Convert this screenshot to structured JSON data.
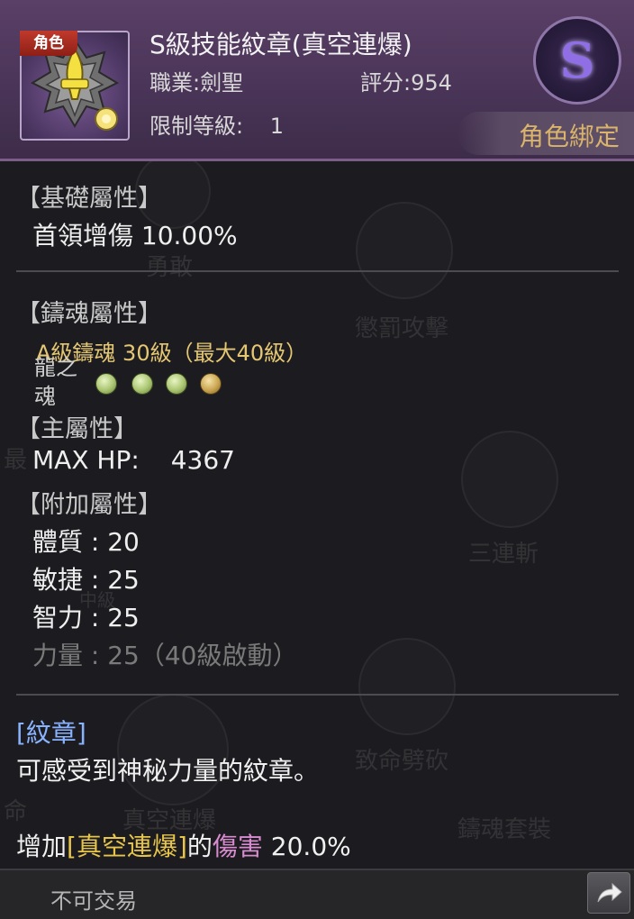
{
  "header": {
    "role_tag": "角色",
    "item_name": "S級技能紋章(真空連爆)",
    "job_label": "職業:",
    "job_value": "劍聖",
    "score_label": "評分:",
    "score_value": "954",
    "level_label": "限制等級:",
    "level_value": "1",
    "grade": "S",
    "bind_status": "角色綁定"
  },
  "basic": {
    "title": "【基礎屬性】",
    "stat": "首領增傷 10.00%"
  },
  "soul": {
    "title": "【鑄魂屬性】",
    "rank": "A級鑄魂 30級（最大40級）",
    "label": "龍之魂",
    "gem_count_green": 3,
    "gem_count_amber": 1
  },
  "main_attr": {
    "title": "【主屬性】",
    "stat_name": "MAX HP:",
    "stat_value": "4367"
  },
  "extra_attr": {
    "title": "【附加屬性】",
    "items": [
      "體質 : 20",
      "敏捷 : 25",
      "智力 : 25"
    ],
    "locked": "力量 : 25（40級啟動）"
  },
  "description": {
    "tag": "[紋章]",
    "text": "可感受到神秘力量的紋章。",
    "effect_prefix": "增加",
    "effect_skill": "[真空連爆]",
    "effect_mid": "的",
    "effect_dmg": "傷害",
    "effect_value": " 20.0%"
  },
  "background_nodes": [
    "勇敢",
    "懲罰攻擊",
    "三連斬",
    "致命劈砍",
    "真空連爆",
    "鑄魂套裝",
    "最",
    "中級",
    "命"
  ],
  "footer": {
    "trade_status": "不可交易"
  },
  "colors": {
    "header_bg": "#4a3558",
    "gold": "#e5c773",
    "bind": "#d9b46a",
    "tag_blue": "#8ab3ff",
    "damage_pink": "#d98bd0",
    "grade_purple": "#8f6ee6"
  },
  "icons": {
    "emblem": "s-skill-emblem-icon",
    "grade": "s-grade-badge",
    "share": "share-arrow-icon"
  }
}
